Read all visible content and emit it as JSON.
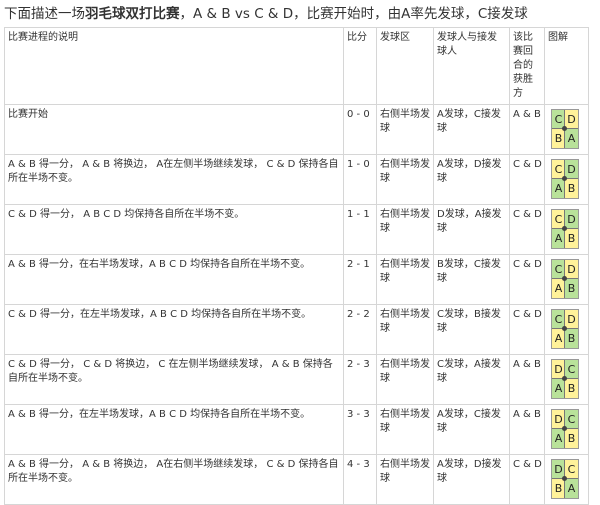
{
  "heading": {
    "pre": "下面描述一场",
    "bold": "羽毛球双打比赛",
    "post": "，A & B vs C & D，比赛开始时，由A率先发球，C接发球"
  },
  "columns": [
    "比赛进程的说明",
    "比分",
    "发球区",
    "发球人与接发球人",
    "该比赛回合的获胜方",
    "图解"
  ],
  "rows": [
    {
      "description": "比赛开始",
      "score": "0 - 0",
      "serve_side": "右侧半场发球",
      "server_receiver": "A发球，C接发球",
      "winner": "A & B",
      "diagram": {
        "tl": "C",
        "tr": "D",
        "bl": "B",
        "br": "A",
        "highlight": [
          "tl",
          "br"
        ]
      }
    },
    {
      "description": "A & B 得一分， A & B 将换边， A在左侧半场继续发球， C & D 保持各自所在半场不变。",
      "score": "1 - 0",
      "serve_side": "右侧半场发球",
      "server_receiver": "A发球，D接发球",
      "winner": "C & D",
      "diagram": {
        "tl": "C",
        "tr": "D",
        "bl": "A",
        "br": "B",
        "highlight": [
          "tr",
          "bl"
        ]
      }
    },
    {
      "description": "C & D 得一分， A B C D 均保持各自所在半场不变。",
      "score": "1 - 1",
      "serve_side": "右侧半场发球",
      "server_receiver": "D发球，A接发球",
      "winner": "C & D",
      "diagram": {
        "tl": "C",
        "tr": "D",
        "bl": "A",
        "br": "B",
        "highlight": [
          "tr",
          "bl"
        ]
      }
    },
    {
      "description": "A & B 得一分，在右半场发球，A B C D 均保持各自所在半场不变。",
      "score": "2 - 1",
      "serve_side": "右侧半场发球",
      "server_receiver": "B发球，C接发球",
      "winner": "C & D",
      "diagram": {
        "tl": "C",
        "tr": "D",
        "bl": "A",
        "br": "B",
        "highlight": [
          "tl",
          "br"
        ]
      }
    },
    {
      "description": "C & D 得一分，在左半场发球，A B C D 均保持各自所在半场不变。",
      "score": "2 - 2",
      "serve_side": "右侧半场发球",
      "server_receiver": "C发球，B接发球",
      "winner": "C & D",
      "diagram": {
        "tl": "C",
        "tr": "D",
        "bl": "A",
        "br": "B",
        "highlight": [
          "tl",
          "br"
        ]
      }
    },
    {
      "description": "C & D 得一分， C & D 将换边， C 在左侧半场继续发球， A & B 保持各自所在半场不变。",
      "score": "2 - 3",
      "serve_side": "右侧半场发球",
      "server_receiver": "C发球，A接发球",
      "winner": "A & B",
      "diagram": {
        "tl": "D",
        "tr": "C",
        "bl": "A",
        "br": "B",
        "highlight": [
          "tr",
          "bl"
        ]
      }
    },
    {
      "description": "A & B 得一分，在左半场发球，A B C D 均保持各自所在半场不变。",
      "score": "3 - 3",
      "serve_side": "右侧半场发球",
      "server_receiver": "A发球，C接发球",
      "winner": "A & B",
      "diagram": {
        "tl": "D",
        "tr": "C",
        "bl": "A",
        "br": "B",
        "highlight": [
          "tr",
          "bl"
        ]
      }
    },
    {
      "description": "A & B 得一分， A & B 将换边， A在右侧半场继续发球， C & D 保持各自所在半场不变。",
      "score": "4 - 3",
      "serve_side": "右侧半场发球",
      "server_receiver": "A发球，D接发球",
      "winner": "C & D",
      "diagram": {
        "tl": "D",
        "tr": "C",
        "bl": "B",
        "br": "A",
        "highlight": [
          "tl",
          "br"
        ]
      }
    }
  ]
}
